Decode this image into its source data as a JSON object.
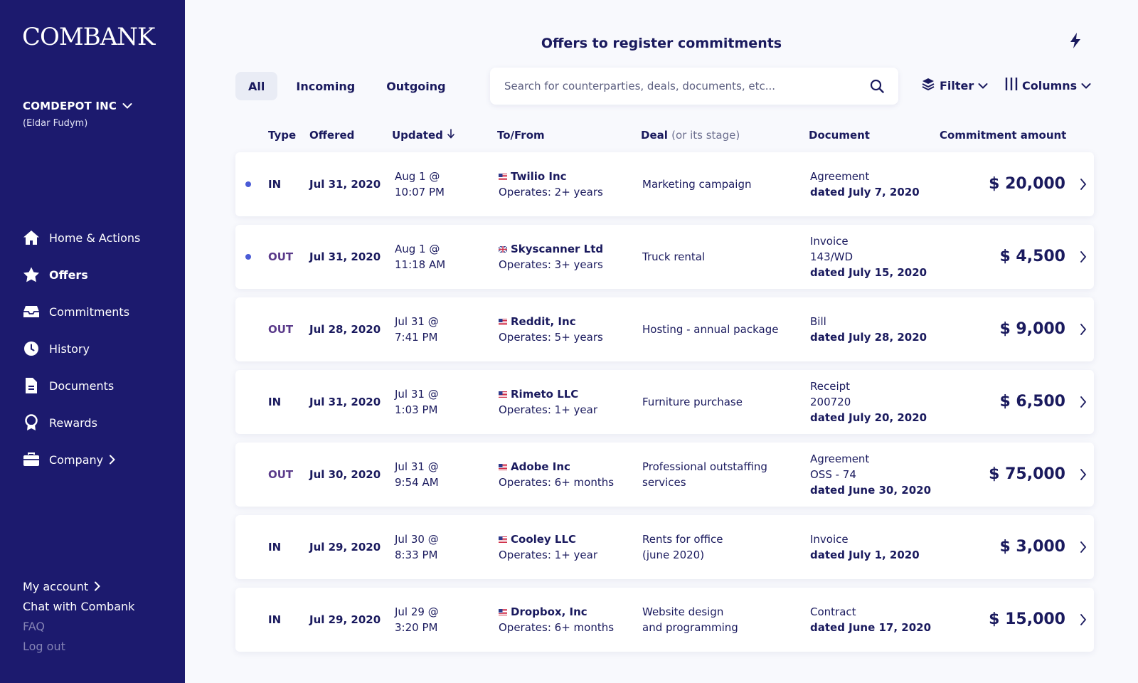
{
  "app": {
    "logo": "COMBANK"
  },
  "company": {
    "name": "COMDEPOT INC",
    "user": "(Eldar Fudym)"
  },
  "nav": [
    {
      "label": "Home & Actions",
      "icon": "home-icon"
    },
    {
      "label": "Offers",
      "icon": "star-icon"
    },
    {
      "label": "Commitments",
      "icon": "inbox-icon"
    },
    {
      "label": "History",
      "icon": "history-icon"
    },
    {
      "label": "Documents",
      "icon": "document-icon"
    },
    {
      "label": "Rewards",
      "icon": "ribbon-icon"
    },
    {
      "label": "Company",
      "icon": "briefcase-icon"
    }
  ],
  "bottom": {
    "account": "My account",
    "chat": "Chat with Combank",
    "faq": "FAQ",
    "logout": "Log out"
  },
  "header": {
    "title": "Offers to register commitments"
  },
  "tabs": [
    {
      "label": "All"
    },
    {
      "label": "Incoming"
    },
    {
      "label": "Outgoing"
    }
  ],
  "search": {
    "placeholder": "Search for counterparties, deals, documents, etc..."
  },
  "toolbar": {
    "filter_label": "Filter",
    "columns_label": "Columns"
  },
  "table": {
    "headers": {
      "type": "Type",
      "offered": "Offered",
      "updated": "Updated",
      "party": "To/From",
      "deal": "Deal",
      "deal_note": "(or its stage)",
      "document": "Document",
      "amount": "Commitment amount"
    },
    "rows": [
      {
        "type": "IN",
        "offered": "Jul 31, 2020",
        "updated_date": "Aug 1 @",
        "updated_time": "10:07 PM",
        "party": "Twilio Inc",
        "operates": "Operates: 2+ years",
        "deal": [
          "Marketing campaign"
        ],
        "doc_type": "Agreement",
        "doc_number": "",
        "doc_date": "dated July 7, 2020",
        "amount": "$ 20,000"
      },
      {
        "type": "OUT",
        "offered": "Jul 31, 2020",
        "updated_date": "Aug 1 @",
        "updated_time": "11:18 AM",
        "party": "Skyscanner Ltd",
        "operates": "Operates: 3+ years",
        "deal": [
          "Truck rental"
        ],
        "doc_type": "Invoice",
        "doc_number": "143/WD",
        "doc_date": "dated July 15, 2020",
        "amount": "$ 4,500"
      },
      {
        "type": "OUT",
        "offered": "Jul 28, 2020",
        "updated_date": "Jul 31 @",
        "updated_time": "7:41 PM",
        "party": "Reddit, Inc",
        "operates": "Operates: 5+ years",
        "deal": [
          "Hosting - annual package"
        ],
        "doc_type": "Bill",
        "doc_number": "",
        "doc_date": "dated July 28, 2020",
        "amount": "$ 9,000"
      },
      {
        "type": "IN",
        "offered": "Jul 31, 2020",
        "updated_date": "Jul 31 @",
        "updated_time": "1:03 PM",
        "party": "Rimeto LLC",
        "operates": "Operates: 1+ year",
        "deal": [
          "Furniture purchase"
        ],
        "doc_type": "Receipt",
        "doc_number": "200720",
        "doc_date": "dated July 20, 2020",
        "amount": "$ 6,500"
      },
      {
        "type": "OUT",
        "offered": "Jul 30, 2020",
        "updated_date": "Jul 31 @",
        "updated_time": "9:54 AM",
        "party": "Adobe Inc",
        "operates": "Operates: 6+ months",
        "deal": [
          "Professional outstaffing",
          "services"
        ],
        "doc_type": "Agreement",
        "doc_number": "OSS - 74",
        "doc_date": "dated June 30, 2020",
        "amount": "$ 75,000"
      },
      {
        "type": "IN",
        "offered": "Jul 29, 2020",
        "updated_date": "Jul 30 @",
        "updated_time": "8:33 PM",
        "party": "Cooley LLC",
        "operates": "Operates: 1+ year",
        "deal": [
          "Rents for office",
          "(june 2020)"
        ],
        "doc_type": "Invoice",
        "doc_number": "",
        "doc_date": "dated July 1, 2020",
        "amount": "$ 3,000"
      },
      {
        "type": "IN",
        "offered": "Jul 29, 2020",
        "updated_date": "Jul 29 @",
        "updated_time": "3:20 PM",
        "party": "Dropbox, Inc",
        "operates": "Operates: 6+ months",
        "deal": [
          "Website design",
          "and programming"
        ],
        "doc_type": "Contract",
        "doc_number": "",
        "doc_date": "dated June 17, 2020",
        "amount": "$ 15,000"
      }
    ]
  },
  "colors": {
    "sidebar": "#1c1a6e",
    "text": "#1a1a5e",
    "unread_dot": "#4a5bd6",
    "background": "#f8f9fd"
  }
}
